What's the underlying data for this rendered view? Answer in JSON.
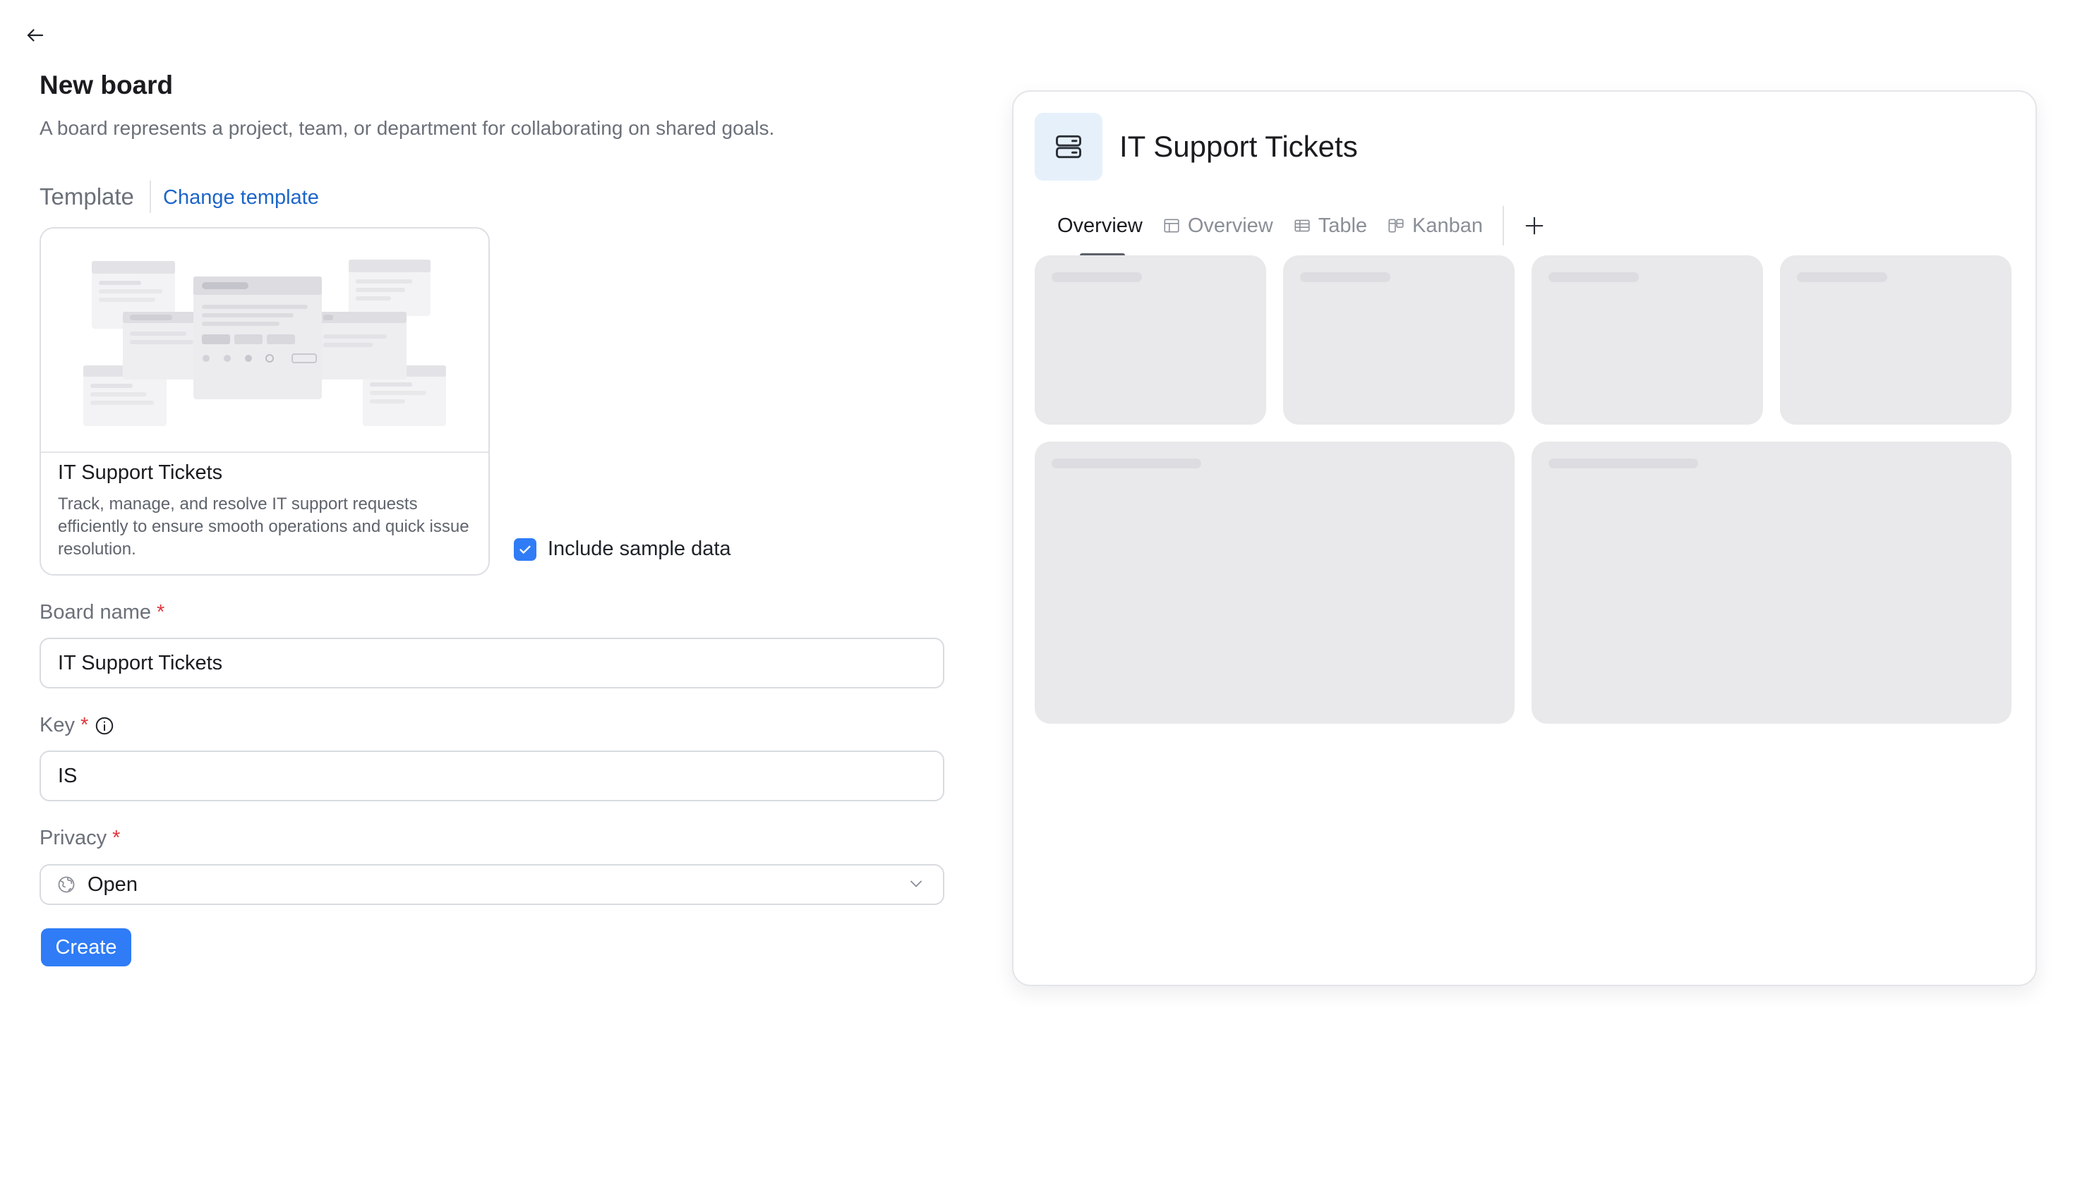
{
  "header": {
    "back_icon": "arrow-left-icon",
    "title": "New board",
    "description": "A board represents a project, team, or department for collaborating on shared goals."
  },
  "template": {
    "label": "Template",
    "change_label": "Change template",
    "card": {
      "name": "IT Support Tickets",
      "description": "Track, manage, and resolve IT support requests efficiently to ensure smooth operations and quick issue resolution."
    },
    "include_sample_label": "Include sample data",
    "include_sample_checked": true
  },
  "form": {
    "board_name": {
      "label": "Board name",
      "required_mark": "*",
      "value": "IT Support Tickets"
    },
    "key": {
      "label": "Key",
      "required_mark": "*",
      "value": "IS",
      "info_icon": "info-circle-icon"
    },
    "privacy": {
      "label": "Privacy",
      "required_mark": "*",
      "value": "Open",
      "icon": "globe-icon"
    },
    "create_label": "Create"
  },
  "preview": {
    "icon": "server-icon",
    "title": "IT Support Tickets",
    "tabs": [
      {
        "label": "Overview",
        "icon": null,
        "active": true
      },
      {
        "label": "Overview",
        "icon": "layout-icon",
        "active": false
      },
      {
        "label": "Table",
        "icon": "table-icon",
        "active": false
      },
      {
        "label": "Kanban",
        "icon": "kanban-icon",
        "active": false
      }
    ],
    "add_tab_icon": "plus-icon"
  },
  "colors": {
    "accent": "#2f7cf6",
    "link": "#1d65c9",
    "required": "#e0363b",
    "skeleton": "#e9e9ec"
  }
}
